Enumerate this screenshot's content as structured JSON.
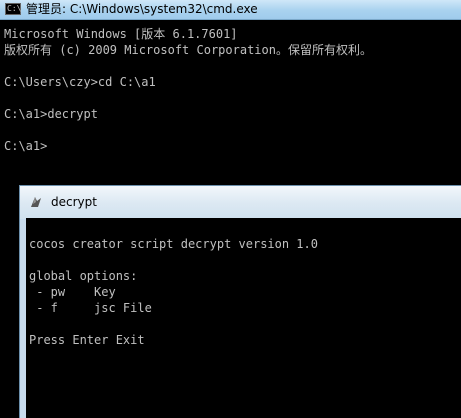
{
  "cmd_window": {
    "title": "管理员: C:\\Windows\\system32\\cmd.exe",
    "icon_label": "C:\\",
    "lines": [
      "Microsoft Windows [版本 6.1.7601]",
      "版权所有 (c) 2009 Microsoft Corporation。保留所有权利。",
      "",
      "C:\\Users\\czy>cd C:\\a1",
      "",
      "C:\\a1>decrypt",
      "",
      "C:\\a1>"
    ]
  },
  "decrypt_window": {
    "title": "decrypt",
    "icon": "app-icon",
    "lines": [
      "",
      "cocos creator script decrypt version 1.0",
      "",
      "global options:",
      " - pw    Key",
      " - f     jsc File",
      "",
      "Press Enter Exit"
    ]
  },
  "colors": {
    "console_bg": "#000000",
    "console_text": "#c0c0c0",
    "titlebar": "#a9d2ef"
  }
}
